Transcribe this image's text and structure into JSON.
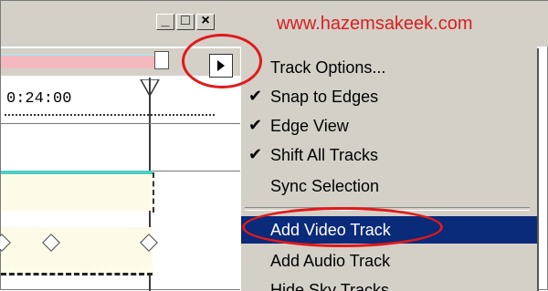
{
  "watermark": "www.hazemsakeek.com",
  "window_controls": {
    "minimize": "_",
    "maximize": "□",
    "close": "×"
  },
  "timeline": {
    "time_label": "0:24:00"
  },
  "menu": {
    "items": [
      {
        "label": "Track Options...",
        "checked": false,
        "selected": false
      },
      {
        "label": "Snap to Edges",
        "checked": true,
        "selected": false
      },
      {
        "label": "Edge View",
        "checked": true,
        "selected": false
      },
      {
        "label": "Shift All Tracks",
        "checked": true,
        "selected": false
      },
      {
        "label": "Sync Selection",
        "checked": false,
        "selected": false
      },
      {
        "label": "Add Video Track",
        "checked": false,
        "selected": true
      },
      {
        "label": "Add Audio Track",
        "checked": false,
        "selected": false
      },
      {
        "label": "Hide Sky Tracks",
        "checked": false,
        "selected": false
      }
    ],
    "check_glyph": "✔"
  },
  "colors": {
    "menu_highlight": "#0a2a7a",
    "annotation_red": "#e01a1a",
    "watermark_red": "#d8201f"
  }
}
